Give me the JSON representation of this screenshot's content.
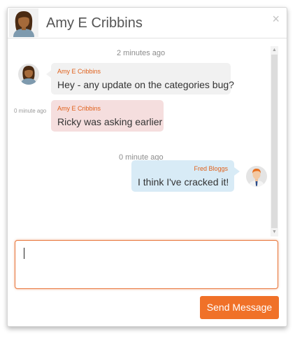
{
  "header": {
    "title": "Amy E Cribbins",
    "close_label": "×"
  },
  "messages": [
    {
      "timestamp": "2 minutes ago",
      "sender": "Amy E Cribbins",
      "text": "Hey - any update on the categories bug?",
      "side": "left"
    },
    {
      "side_timestamp": "0 minute ago",
      "sender": "Amy E Cribbins",
      "text": "Ricky was asking earlier",
      "side": "left"
    },
    {
      "timestamp": "0 minute ago",
      "sender": "Fred Bloggs",
      "text": "I think I've cracked it!",
      "side": "right"
    }
  ],
  "composer": {
    "value": "",
    "send_label": "Send Message"
  },
  "colors": {
    "accent": "#f07128",
    "sender_name": "#e0601a",
    "bubble_grey": "#f1f1f1",
    "bubble_pink": "#f5dede",
    "bubble_blue": "#d8ebf6"
  },
  "icons": {
    "close": "close-icon",
    "scroll_up": "chevron-up-icon",
    "scroll_down": "chevron-down-icon"
  }
}
